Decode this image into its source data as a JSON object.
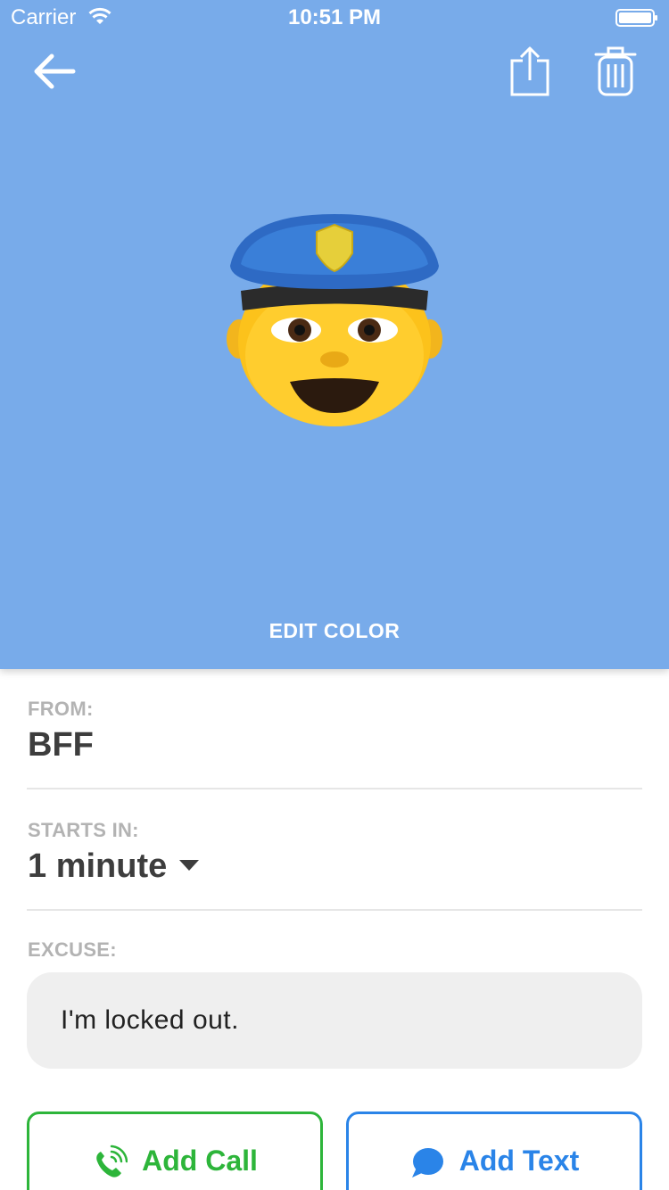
{
  "status_bar": {
    "carrier": "Carrier",
    "time": "10:51 PM",
    "icons": [
      "wifi-icon",
      "battery-icon"
    ]
  },
  "header": {
    "background_color": "#78abea",
    "icons": [
      "back-arrow-icon",
      "share-icon",
      "trash-icon"
    ],
    "avatar_icon": "police-officer-emoji",
    "edit_color_label": "EDIT COLOR"
  },
  "form": {
    "from_label": "FROM:",
    "from_value": "BFF",
    "starts_in_label": "STARTS IN:",
    "starts_in_value": "1 minute",
    "excuse_label": "EXCUSE:",
    "excuse_value": "I'm locked out."
  },
  "actions": {
    "add_call_label": "Add Call",
    "add_call_color": "#2db53a",
    "add_text_label": "Add Text",
    "add_text_color": "#2a84e8"
  }
}
